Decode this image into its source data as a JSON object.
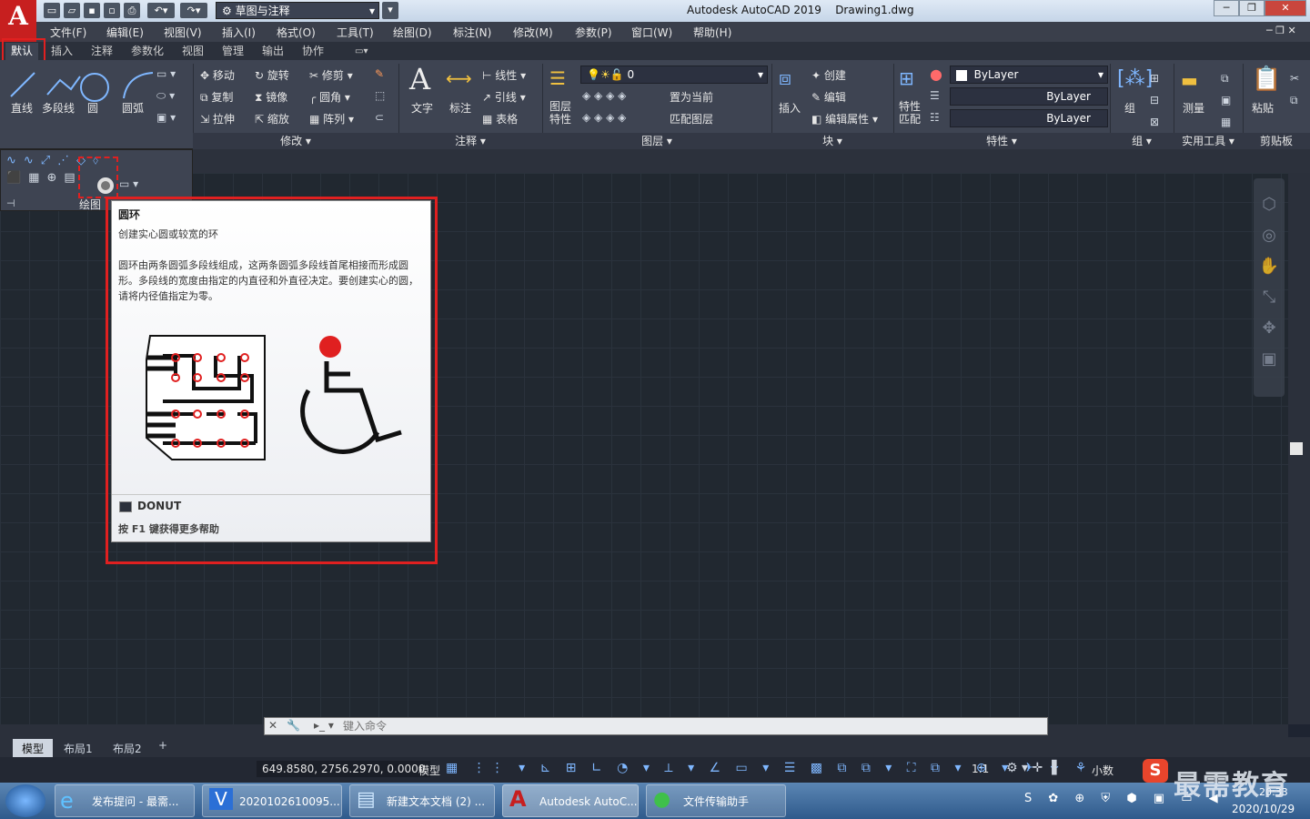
{
  "title": {
    "app_name": "Autodesk AutoCAD 2019",
    "file_name": "Drawing1.dwg",
    "workspace": "草图与注释"
  },
  "menu": [
    "文件(F)",
    "编辑(E)",
    "视图(V)",
    "插入(I)",
    "格式(O)",
    "工具(T)",
    "绘图(D)",
    "标注(N)",
    "修改(M)",
    "参数(P)",
    "窗口(W)",
    "帮助(H)"
  ],
  "ribbon_tabs": [
    "默认",
    "插入",
    "注释",
    "参数化",
    "视图",
    "管理",
    "输出",
    "协作"
  ],
  "ribbon": {
    "draw": {
      "line": "直线",
      "polyline": "多段线",
      "circle": "圆",
      "arc": "圆弧",
      "title": "绘图"
    },
    "modify": {
      "move": "移动",
      "rotate": "旋转",
      "trim": "修剪",
      "copy": "复制",
      "mirror": "镜像",
      "fillet": "圆角",
      "stretch": "拉伸",
      "scale": "缩放",
      "array": "阵列",
      "title": "修改"
    },
    "annotation": {
      "text": "文字",
      "dimension": "标注",
      "linear": "线性",
      "leader": "引线",
      "table": "表格",
      "title": "注释"
    },
    "layers": {
      "layer_props": "图层特性",
      "current_layer": "0",
      "set_current": "置为当前",
      "match_layer": "匹配图层",
      "title": "图层"
    },
    "block": {
      "insert": "插入",
      "create": "创建",
      "edit": "编辑",
      "edit_attr": "编辑属性",
      "title": "块"
    },
    "properties": {
      "match": "特性匹配",
      "color": "ByLayer",
      "linetype": "ByLayer",
      "lineweight": "ByLayer",
      "title": "特性"
    },
    "groups": {
      "group": "组",
      "title": "组"
    },
    "utilities": {
      "measure": "测量",
      "title": "实用工具"
    },
    "clipboard": {
      "paste": "粘贴",
      "title": "剪贴板"
    }
  },
  "tooltip": {
    "title": "圆环",
    "subtitle": "创建实心圆或较宽的环",
    "description": "圆环由两条圆弧多段线组成，这两条圆弧多段线首尾相接而形成圆形。多段线的宽度由指定的内直径和外直径决定。要创建实心的圆，请将内径值指定为零。",
    "command": "DONUT",
    "help": "按 F1 键获得更多帮助"
  },
  "command_line": {
    "placeholder": "键入命令"
  },
  "layout_tabs": [
    "模型",
    "布局1",
    "布局2"
  ],
  "status": {
    "coords": "649.8580, 2756.2970, 0.0000",
    "model": "模型",
    "scale": "1:1",
    "units": "小数"
  },
  "taskbar": {
    "items": [
      "发布提问 - 最需...",
      "2020102610095...",
      "新建文本文档 (2) ...",
      "Autodesk AutoC...",
      "文件传输助手"
    ],
    "time": "20:33",
    "date": "2020/10/29",
    "watermark": "最需教育"
  },
  "colors": {
    "accent_red": "#e02020",
    "canvas": "#212830",
    "ribbon": "#3e4452"
  }
}
